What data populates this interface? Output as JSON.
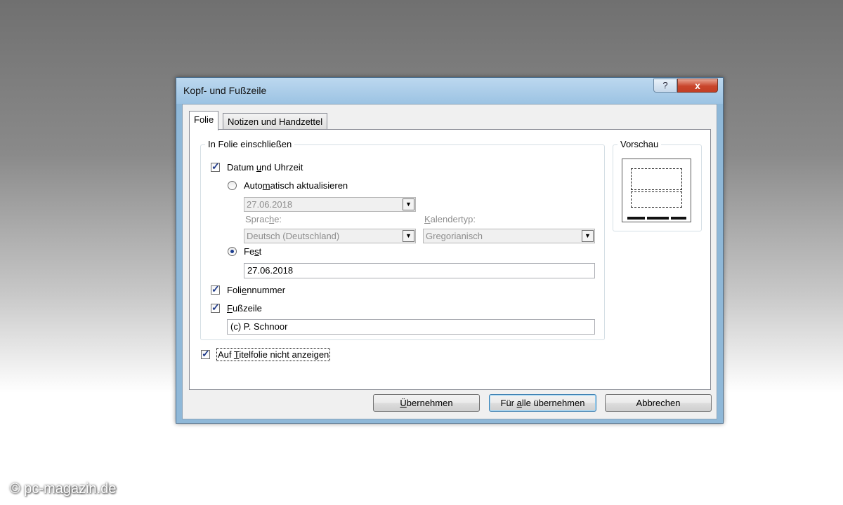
{
  "dialog": {
    "title": "Kopf- und Fußzeile",
    "help_label": "?",
    "close_label": "x"
  },
  "tabs": [
    {
      "label": "Folie",
      "active": true
    },
    {
      "label": "Notizen und Handzettel",
      "active": false
    }
  ],
  "include": {
    "group_title": "In Folie einschließen",
    "datetime": {
      "checked": true,
      "label_pre": "Datum ",
      "label_u": "u",
      "label_post": "nd Uhrzeit",
      "auto": {
        "selected": false,
        "label_pre": "Auto",
        "label_u": "m",
        "label_post": "atisch aktualisieren",
        "date_value": "27.06.2018",
        "language_label_pre": "Sprac",
        "language_label_u": "h",
        "language_label_post": "e:",
        "language_value": "Deutsch (Deutschland)",
        "calendar_label_pre": "",
        "calendar_label_u": "K",
        "calendar_label_post": "alendertyp:",
        "calendar_value": "Gregorianisch"
      },
      "fixed": {
        "selected": true,
        "label_pre": "Fe",
        "label_u": "s",
        "label_post": "t",
        "value": "27.06.2018"
      }
    },
    "slide_number": {
      "checked": true,
      "label_pre": "Foli",
      "label_u": "e",
      "label_post": "nnummer"
    },
    "footer": {
      "checked": true,
      "label_pre": "",
      "label_u": "F",
      "label_post": "ußzeile",
      "value": "(c) P. Schnoor"
    }
  },
  "title_slide": {
    "checked": true,
    "label_pre": "Auf ",
    "label_u": "T",
    "label_post": "itelfolie nicht anzeigen"
  },
  "preview": {
    "group_title": "Vorschau"
  },
  "buttons": {
    "apply_pre": "",
    "apply_u": "Ü",
    "apply_post": "bernehmen",
    "apply_all_pre": "Für ",
    "apply_all_u": "a",
    "apply_all_post": "lle übernehmen",
    "cancel": "Abbrechen"
  },
  "watermark": "© pc-magazin.de"
}
